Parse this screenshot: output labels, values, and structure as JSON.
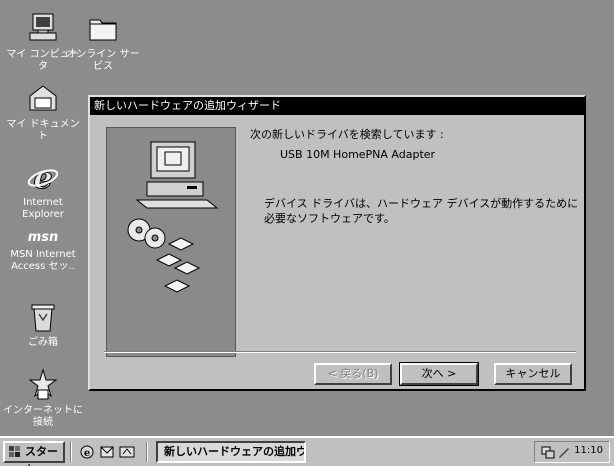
{
  "desktop_icons": [
    {
      "label": "マイ コンピュータ",
      "icon": "my-computer-icon"
    },
    {
      "label": "オンライン サービス",
      "icon": "online-services-folder-icon"
    },
    {
      "label": "マイ ドキュメント",
      "icon": "my-documents-icon"
    },
    {
      "label": "Internet Explorer",
      "icon": "internet-explorer-icon"
    },
    {
      "label": "MSN Internet Access セッ..",
      "icon": "msn-icon"
    },
    {
      "label": "ごみ箱",
      "icon": "recycle-bin-icon"
    },
    {
      "label": "インターネットに 接続",
      "icon": "connect-internet-icon"
    }
  ],
  "wizard": {
    "title": "新しいハードウェアの追加ウィザード",
    "searching_text": "次の新しいドライバを検索しています :",
    "device_name": "USB 10M HomePNA Adapter",
    "description": "デバイス ドライバは、ハードウェア デバイスが動作するために必要なソフトウェアです。",
    "buttons": {
      "back": "< 戻る(B)",
      "next": "次へ >",
      "cancel": "キャンセル"
    }
  },
  "taskbar": {
    "start_label": "スタート",
    "task_label": "新しいハードウェアの追加ウ...",
    "clock": "11:10"
  },
  "colors": {
    "desktop": "#8c8c8c",
    "titlebar": "#000000",
    "face": "#c0c0c0"
  }
}
